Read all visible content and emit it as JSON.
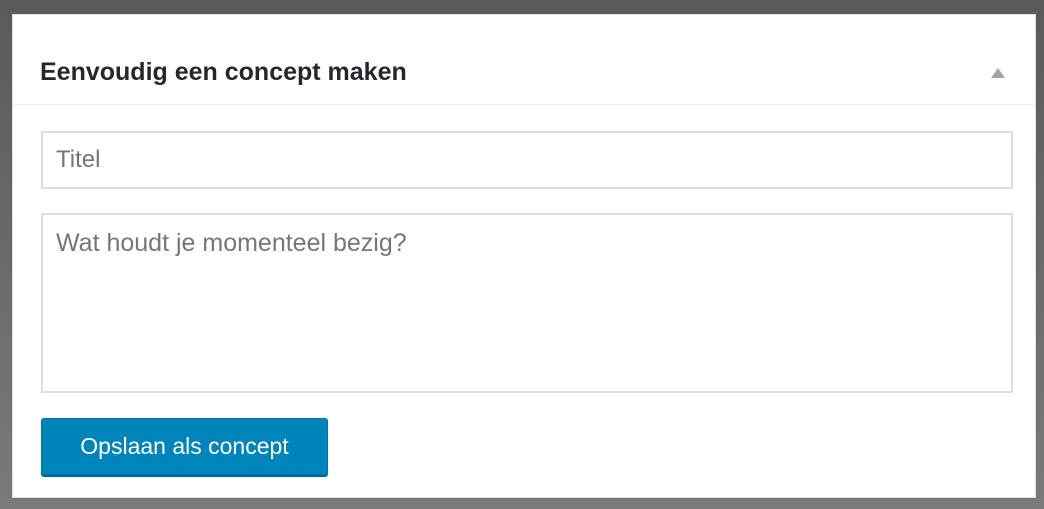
{
  "widget": {
    "title": "Eenvoudig een concept maken",
    "title_input_placeholder": "Titel",
    "content_placeholder": "Wat houdt je momenteel bezig?",
    "save_label": "Opslaan als concept",
    "toggle_icon": "arrow-up-icon"
  },
  "colors": {
    "accent": "#0085ba",
    "border": "#dddddd",
    "title_text": "#23282d",
    "placeholder_text": "#72777c"
  }
}
